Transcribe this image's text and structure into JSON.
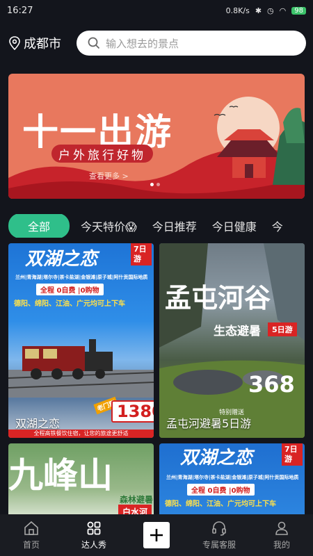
{
  "statusbar": {
    "time": "16:27",
    "network": "0.8K/s",
    "battery": "98"
  },
  "header": {
    "city": "成都市",
    "search_placeholder": "输入想去的景点"
  },
  "banner": {
    "title": "十一出游",
    "subtitle": "户外旅行好物",
    "more": "查看更多 >",
    "slides": 2,
    "active_slide": 0
  },
  "tabs": [
    {
      "label": "全部",
      "active": true
    },
    {
      "label": "今天特价😱",
      "active": false
    },
    {
      "label": "今日推荐",
      "active": false
    },
    {
      "label": "今日健康",
      "active": false
    },
    {
      "label": "今",
      "active": false
    }
  ],
  "cards": [
    {
      "caption": "双湖之恋",
      "heading": "双湖之恋",
      "days_badge": "7日游",
      "route": "兰州|青海湖|塔尔寺|茶卡盐湖|金银滩|原子城|阿什贡国际地质公园",
      "promo": "全程 0自费 |0购物",
      "pickup": "德阳、绵阳、江油、广元均可上下车",
      "price": "1380",
      "price_tag": "老门票",
      "footer": "全程高铁餐饮住宿，让您的旅途更舒适"
    },
    {
      "caption": "孟屯河避暑5日游",
      "heading": "孟屯河谷",
      "sub_heading": "生态避暑",
      "days_badge": "5日游",
      "price": "368",
      "gift": "特别赠送"
    },
    {
      "heading": "九峰山",
      "tag1": "森林避暑",
      "tag2": "白水河"
    },
    {
      "heading": "双湖之恋",
      "days_badge": "7日游",
      "route": "兰州|青海湖|塔尔寺|茶卡盐湖|金银滩|原子城|阿什贡国际地质公园",
      "promo": "全程 0自费 |0购物",
      "pickup": "德阳、绵阳、江油、广元均可上下车"
    }
  ],
  "bottom_nav": [
    {
      "label": "首页",
      "icon": "home-icon",
      "active": false
    },
    {
      "label": "达人秀",
      "icon": "grid-icon",
      "active": true
    },
    {
      "label": "",
      "icon": "plus-icon",
      "active": false
    },
    {
      "label": "专属客服",
      "icon": "headset-icon",
      "active": false
    },
    {
      "label": "我的",
      "icon": "user-icon",
      "active": false
    }
  ],
  "colors": {
    "accent": "#2fbf8a",
    "banner_bg": "#e8785e",
    "badge_red": "#d92424",
    "page_bg": "#13151c"
  }
}
